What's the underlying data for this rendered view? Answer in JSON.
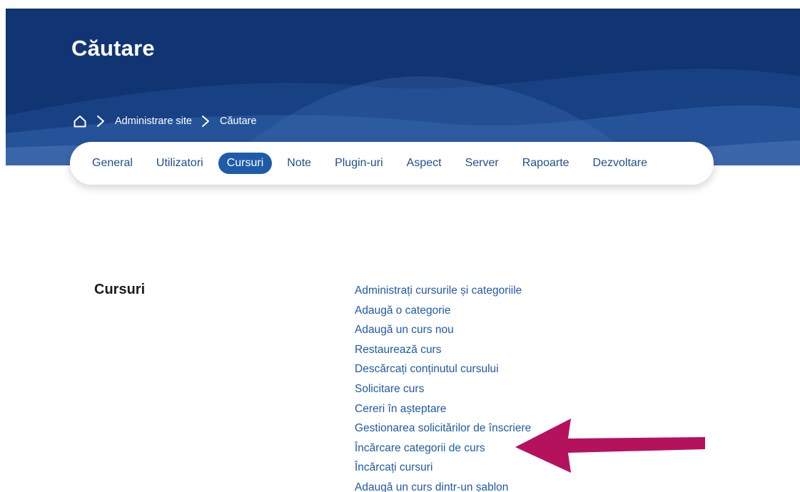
{
  "header": {
    "title": "Căutare",
    "breadcrumb": {
      "home_icon": "home-icon",
      "items": [
        "Administrare site",
        "Căutare"
      ]
    }
  },
  "nav": {
    "tabs": [
      "General",
      "Utilizatori",
      "Cursuri",
      "Note",
      "Plugin-uri",
      "Aspect",
      "Server",
      "Rapoarte",
      "Dezvoltare"
    ],
    "active": "Cursuri"
  },
  "section": {
    "heading": "Cursuri",
    "links": [
      "Administrați cursurile și categoriile",
      "Adaugă o categorie",
      "Adaugă un curs nou",
      "Restaurează curs",
      "Descărcați conținutul cursului",
      "Solicitare curs",
      "Cereri în așteptare",
      "Gestionarea solicitărilor de înscriere",
      "Încărcare categorii de curs",
      "Încărcați cursuri",
      "Adaugă un curs dintr-un șablon"
    ]
  },
  "annotation": {
    "icon": "arrow-left-icon",
    "color": "#b5125e",
    "points_to": "Încărcare categorii de curs"
  },
  "colors": {
    "header_bg": "#113472",
    "link": "#1f5aa8",
    "active_tab_bg": "#1e5ba8"
  }
}
